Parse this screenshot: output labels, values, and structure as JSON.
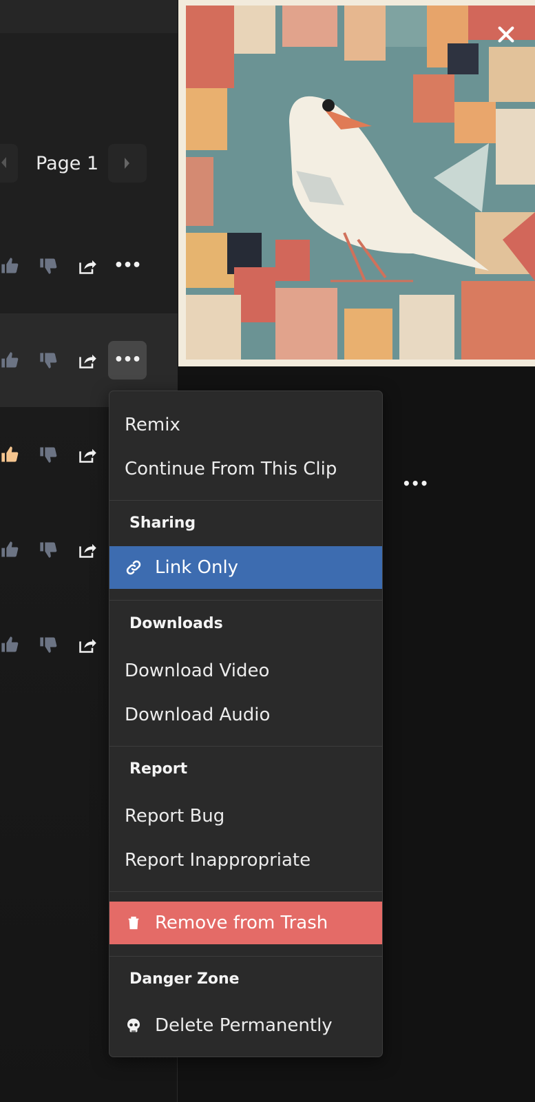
{
  "pager": {
    "page_label": "Page 1"
  },
  "icons": {
    "thumbs_up": "thumbs-up-icon",
    "thumbs_down": "thumbs-down-icon",
    "share": "share-icon",
    "more": "more-horizontal-icon",
    "close": "close-icon",
    "link": "link-icon",
    "trash": "trash-icon",
    "skull": "skull-icon"
  },
  "colors": {
    "liked_accent": "#f5c58f",
    "menu_highlight": "#3d6cb0",
    "danger_highlight": "#e46b67"
  },
  "more_label": "•••",
  "menu": {
    "remix": "Remix",
    "continue": "Continue From This Clip",
    "sharing_heading": "Sharing",
    "link_only": "Link Only",
    "downloads_heading": "Downloads",
    "download_video": "Download Video",
    "download_audio": "Download Audio",
    "report_heading": "Report",
    "report_bug": "Report Bug",
    "report_inappropriate": "Report Inappropriate",
    "remove_from_trash": "Remove from Trash",
    "danger_heading": "Danger Zone",
    "delete_permanently": "Delete Permanently"
  }
}
